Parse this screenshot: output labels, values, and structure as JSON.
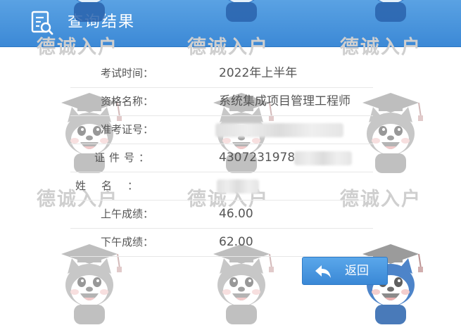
{
  "header": {
    "title": "查询结果",
    "icon": "document-search-icon",
    "background_color": "#3c89d6"
  },
  "watermark": {
    "text": "德诚入户",
    "mascot": "graduate-husky-mascot"
  },
  "results": {
    "exam_time_label": "考试时间：",
    "exam_time_value": "2022年上半年",
    "qualification_label": "资格名称：",
    "qualification_value": "系统集成项目管理工程师",
    "admission_label": "准考证号：",
    "admission_value": "",
    "id_label": "证件号：",
    "id_value": "4307231978",
    "name_label": "姓名：",
    "name_value": "",
    "morning_label": "上午成绩：",
    "morning_value": "46.00",
    "afternoon_label": "下午成绩：",
    "afternoon_value": "62.00"
  },
  "actions": {
    "back_label": "返回",
    "back_icon": "back-arrow-icon"
  }
}
